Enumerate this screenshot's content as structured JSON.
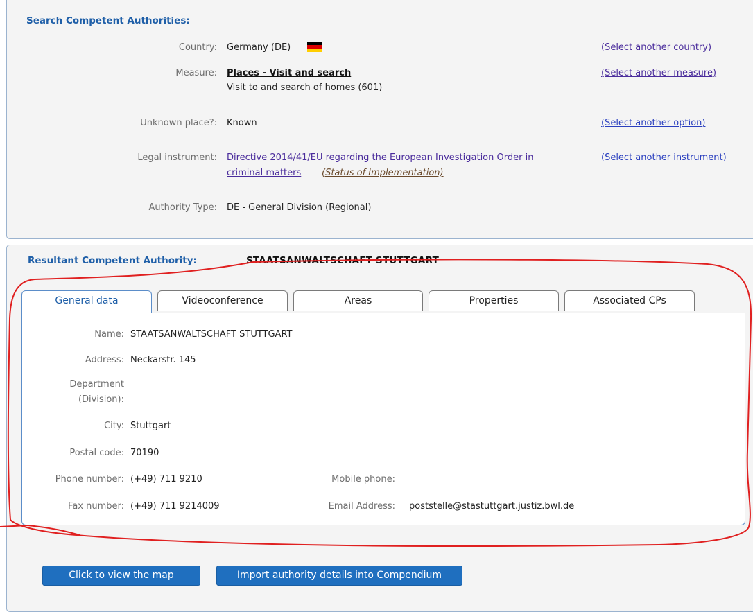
{
  "search": {
    "heading": "Search Competent Authorities:",
    "country_label": "Country:",
    "country_value": "Germany (DE)",
    "country_flag_colors": [
      "#000000",
      "#dd0000",
      "#ffce00"
    ],
    "country_link": "(Select another country)",
    "measure_label": "Measure:",
    "measure_title": "Places - Visit and search",
    "measure_detail": "Visit to and search of homes (601)",
    "measure_link": "(Select another measure)",
    "unknown_place_label": "Unknown place?:",
    "unknown_place_value": "Known",
    "unknown_place_link": "(Select another option)",
    "legal_label": "Legal instrument:",
    "legal_line1": "Directive 2014/41/EU regarding the European Investigation Order in",
    "legal_line2": "criminal matters",
    "legal_status": "(Status of Implementation)",
    "legal_link": "(Select another instrument)",
    "authority_type_label": "Authority Type:",
    "authority_type_value": "DE - General Division (Regional)"
  },
  "result": {
    "heading": "Resultant Competent Authority:",
    "authority_name": "STAATSANWALTSCHAFT STUTTGART",
    "tabs": [
      {
        "label": "General data",
        "active": true
      },
      {
        "label": "Videoconference",
        "active": false
      },
      {
        "label": "Areas",
        "active": false
      },
      {
        "label": "Properties",
        "active": false
      },
      {
        "label": "Associated CPs",
        "active": false
      }
    ],
    "general": {
      "name_label": "Name:",
      "name_value": "STAATSANWALTSCHAFT STUTTGART",
      "address_label": "Address:",
      "address_value": "Neckarstr. 145",
      "department_label_1": "Department",
      "department_label_2": "(Division):",
      "city_label": "City:",
      "city_value": "Stuttgart",
      "postal_label": "Postal code:",
      "postal_value": "70190",
      "phone_label": "Phone number:",
      "phone_value": "(+49) 711 9210",
      "mobile_label": "Mobile phone:",
      "fax_label": "Fax number:",
      "fax_value": "(+49) 711 9214009",
      "email_label": "Email Address:",
      "email_value": "poststelle@stastuttgart.justiz.bwl.de"
    }
  },
  "buttons": {
    "map": "Click to view the map",
    "import": "Import authority details into Compendium"
  },
  "colors": {
    "heading": "#1f5fa8",
    "button": "#1f6fbf",
    "annotation": "#e02020"
  }
}
